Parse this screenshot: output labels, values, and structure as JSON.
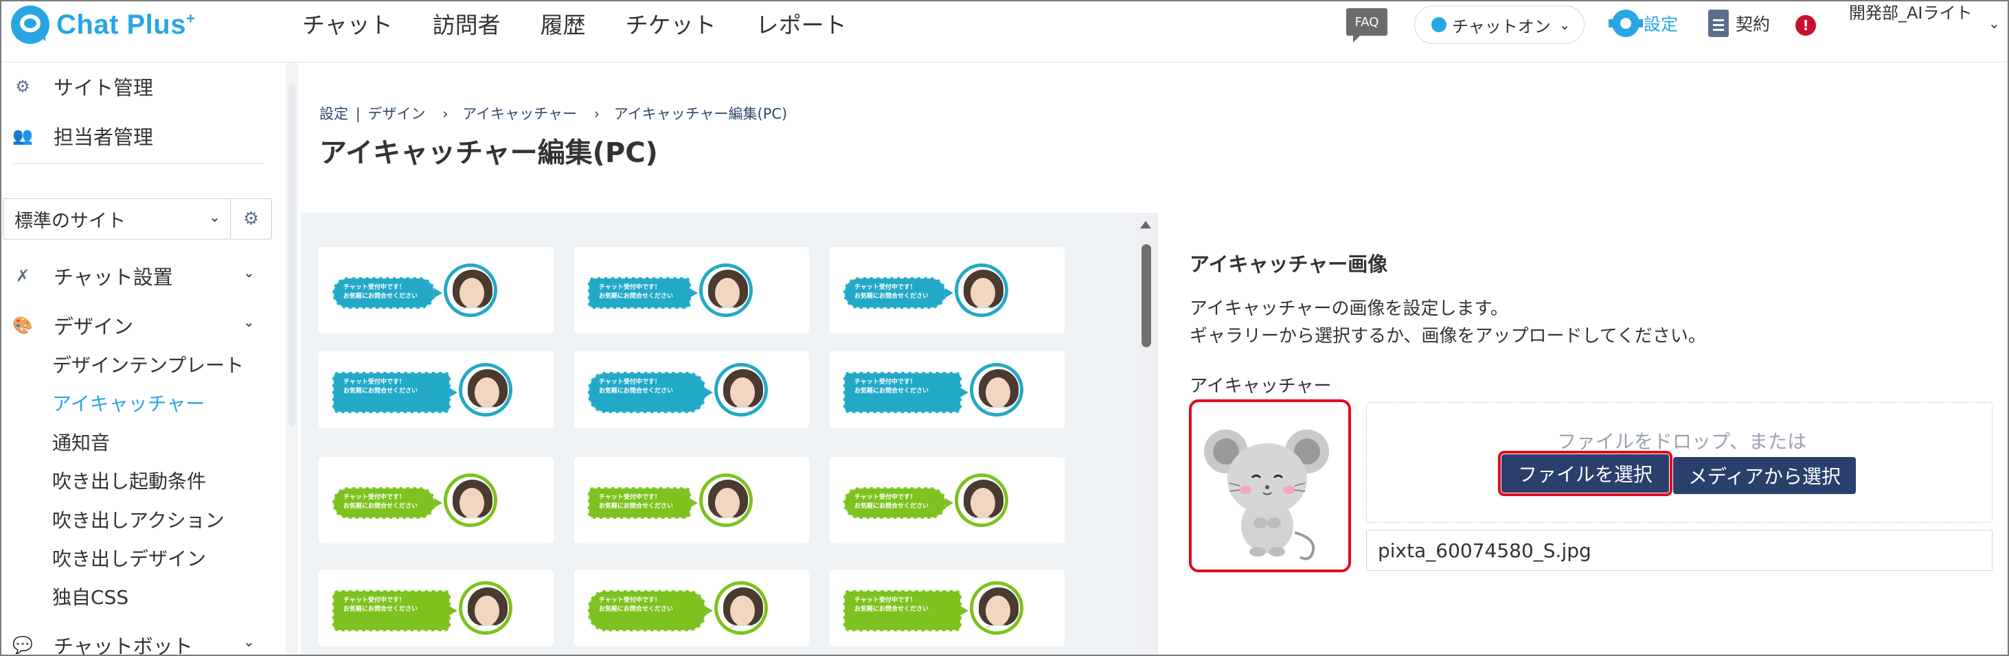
{
  "header": {
    "logo_text": "Chat Plus",
    "logo_sup": "+",
    "nav": [
      "チャット",
      "訪問者",
      "履歴",
      "チケット",
      "レポート"
    ],
    "faq_label": "FAQ",
    "chat_status": "チャットオン",
    "settings_label": "設定",
    "contract_label": "契約",
    "alert_symbol": "!",
    "user_name": "開発部_AIライト"
  },
  "sidebar": {
    "site_admin": "サイト管理",
    "staff_admin": "担当者管理",
    "site_select": "標準のサイト",
    "chat_settings": "チャット設置",
    "design": "デザイン",
    "design_items": [
      "デザインテンプレート",
      "アイキャッチャー",
      "通知音",
      "吹き出し起動条件",
      "吹き出しアクション",
      "吹き出しデザイン",
      "独自CSS"
    ],
    "active_item": "アイキャッチャー",
    "chatbot": "チャットボット"
  },
  "breadcrumb": [
    "設定",
    "|",
    "デザイン",
    "›",
    "アイキャッチャー",
    "›",
    "アイキャッチャー編集(PC)"
  ],
  "page_title": "アイキャッチャー編集(PC)",
  "gallery": {
    "bubble_line1": "チャット受付中です！",
    "bubble_line2": "お気軽にお問合せください",
    "colors": {
      "blue": "#23a9c8",
      "green": "#7dc21e",
      "white": "#ffffff"
    },
    "rows": [
      [
        {
          "color": "blue",
          "shape": "round"
        },
        {
          "color": "blue",
          "shape": "rect"
        },
        {
          "color": "blue",
          "shape": "round"
        }
      ],
      [
        {
          "color": "blue",
          "shape": "rect"
        },
        {
          "color": "blue",
          "shape": "round"
        },
        {
          "color": "blue",
          "shape": "rect"
        }
      ],
      [
        {
          "color": "green",
          "shape": "round"
        },
        {
          "color": "green",
          "shape": "rect"
        },
        {
          "color": "green",
          "shape": "round"
        }
      ],
      [
        {
          "color": "green",
          "shape": "rect"
        },
        {
          "color": "green",
          "shape": "round"
        },
        {
          "color": "green",
          "shape": "rect"
        }
      ]
    ]
  },
  "panel": {
    "title": "アイキャッチャー画像",
    "desc_line1": "アイキャッチャーの画像を設定します。",
    "desc_line2": "ギャラリーから選択するか、画像をアップロードしてください。",
    "field_label": "アイキャッチャー",
    "drop_text": "ファイルをドロップ、または",
    "select_file_button": "ファイルを選択",
    "media_button": "メディアから選択",
    "filename": "pixta_60074580_S.jpg",
    "highlight_color": "#e3071d",
    "button_color": "#2a3f6b"
  }
}
